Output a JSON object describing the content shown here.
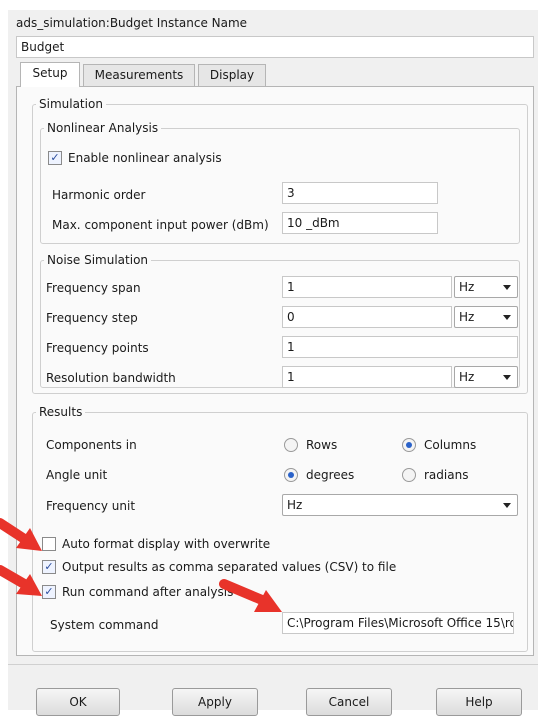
{
  "dialog": {
    "title": "ads_simulation:Budget Instance Name",
    "instance_name": "Budget"
  },
  "tabs": [
    {
      "label": "Setup",
      "active": true
    },
    {
      "label": "Measurements",
      "active": false
    },
    {
      "label": "Display",
      "active": false
    }
  ],
  "simulation": {
    "title": "Simulation",
    "nonlinear": {
      "title": "Nonlinear Analysis",
      "enable_label": "Enable nonlinear analysis",
      "enable_checked": true,
      "harmonic_order_label": "Harmonic order",
      "harmonic_order_value": "3",
      "max_power_label": "Max. component input power (dBm)",
      "max_power_value": "10 _dBm"
    },
    "noise": {
      "title": "Noise Simulation",
      "freq_span_label": "Frequency span",
      "freq_span_value": "1",
      "freq_span_unit": "Hz",
      "freq_step_label": "Frequency step",
      "freq_step_value": "0",
      "freq_step_unit": "Hz",
      "freq_points_label": "Frequency points",
      "freq_points_value": "1",
      "res_bw_label": "Resolution bandwidth",
      "res_bw_value": "1",
      "res_bw_unit": "Hz"
    }
  },
  "results": {
    "title": "Results",
    "components_label": "Components in",
    "rows_label": "Rows",
    "columns_label": "Columns",
    "components_selected": "Columns",
    "angle_label": "Angle unit",
    "degrees_label": "degrees",
    "radians_label": "radians",
    "angle_selected": "degrees",
    "freq_unit_label": "Frequency unit",
    "freq_unit_value": "Hz",
    "auto_format_label": "Auto format display with overwrite",
    "auto_format_checked": false,
    "output_csv_label": "Output results as comma separated values (CSV) to file",
    "output_csv_checked": true,
    "run_command_label": "Run command after analysis",
    "run_command_checked": true,
    "system_command_label": "System command",
    "system_command_value": "C:\\Program Files\\Microsoft Office 15\\ro"
  },
  "buttons": {
    "ok": "OK",
    "apply": "Apply",
    "cancel": "Cancel",
    "help": "Help"
  },
  "colors": {
    "annotation_arrow": "#e8332a",
    "radio_selected": "#2a62c9"
  },
  "icons": {
    "check": "✓"
  }
}
